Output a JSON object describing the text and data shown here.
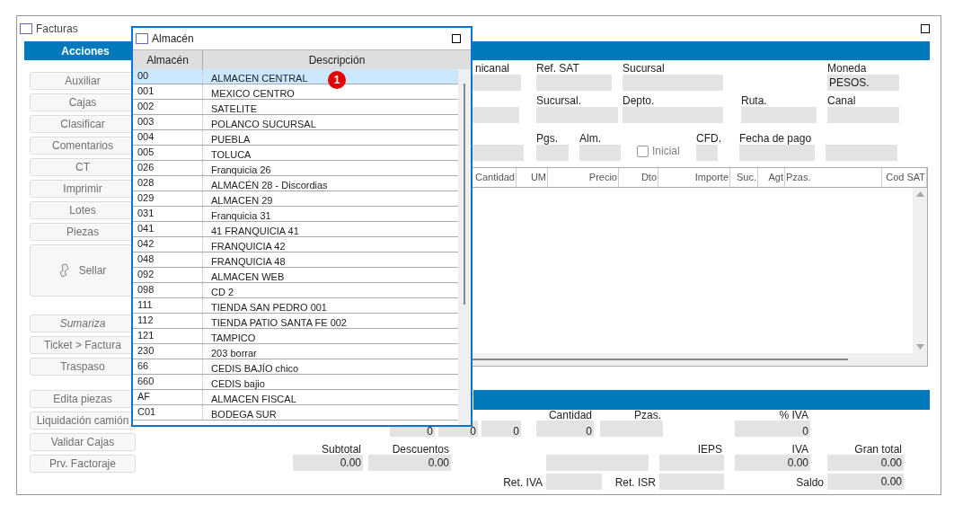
{
  "window": {
    "title": "Facturas"
  },
  "actions": {
    "title": "Acciones",
    "groups": [
      [
        {
          "label": "Auxiliar",
          "kind": "normal"
        },
        {
          "label": "Cajas",
          "kind": "normal"
        },
        {
          "label": "Clasificar",
          "kind": "normal"
        },
        {
          "label": "Comentarios",
          "kind": "normal"
        },
        {
          "label": "CT",
          "kind": "normal"
        },
        {
          "label": "Imprimir",
          "kind": "normal"
        },
        {
          "label": "Lotes",
          "kind": "normal"
        },
        {
          "label": "Piezas",
          "kind": "normal"
        },
        {
          "label": "Sellar",
          "kind": "large"
        }
      ],
      [
        {
          "label": "Sumariza",
          "kind": "italic"
        },
        {
          "label": "Ticket > Factura",
          "kind": "normal"
        },
        {
          "label": "Traspaso",
          "kind": "normal"
        }
      ],
      [
        {
          "label": "Edita piezas",
          "kind": "normal"
        },
        {
          "label": "Liquidación camión",
          "kind": "normal"
        },
        {
          "label": "Validar Cajas",
          "kind": "normal"
        },
        {
          "label": "Prv. Factoraje",
          "kind": "normal"
        }
      ]
    ]
  },
  "header_fields": [
    [
      {
        "kind": "field",
        "label": "nicanal"
      },
      {
        "kind": "field",
        "label": "Ref. SAT"
      },
      {
        "kind": "field",
        "label": "Sucursal"
      },
      {
        "kind": "field",
        "label": "Moneda",
        "value": "PESOS."
      }
    ],
    [
      {
        "kind": "field"
      },
      {
        "kind": "field",
        "label": "Sucursal."
      },
      {
        "kind": "field",
        "label": "Depto."
      },
      {
        "kind": "field",
        "label": "Ruta."
      },
      {
        "kind": "field",
        "label": "Canal"
      }
    ],
    [
      {
        "kind": "field"
      },
      {
        "kind": "field",
        "label": "Pgs."
      },
      {
        "kind": "field",
        "label": "Alm."
      },
      {
        "kind": "checkbox",
        "label": "Inicial",
        "checked": false
      },
      {
        "kind": "field",
        "label": "CFD."
      },
      {
        "kind": "field",
        "label": "Fecha de pago"
      },
      {
        "kind": "field"
      }
    ]
  ],
  "lines_table": {
    "columns": [
      "Cantidad",
      "UM",
      "Precio",
      "Dto",
      "Importe",
      "Suc.",
      "Agt",
      "Pzas.",
      "Cod SAT"
    ]
  },
  "summary": [
    [
      {
        "kind": "field",
        "value": "0"
      },
      {
        "kind": "field",
        "value": "0"
      },
      {
        "kind": "field",
        "value": "0"
      },
      {
        "kind": "field",
        "label": "Cantidad",
        "value": "0"
      },
      {
        "kind": "field",
        "label": "Pzas."
      },
      {
        "kind": "field",
        "label": "% IVA",
        "value": "0"
      }
    ],
    [
      {
        "kind": "field",
        "label": "Subtotal",
        "value": "0.00"
      },
      {
        "kind": "field",
        "label": "Descuentos",
        "value": "0.00"
      },
      {
        "kind": "field"
      },
      {
        "kind": "field",
        "label": "IEPS"
      },
      {
        "kind": "field",
        "label": "IVA",
        "value": "0.00"
      },
      {
        "kind": "field",
        "label": "Gran total",
        "value": "0.00"
      }
    ],
    [
      {
        "kind": "field",
        "label": "Ret. IVA"
      },
      {
        "kind": "field",
        "label": "Ret. ISR"
      },
      {
        "kind": "field",
        "label": "Saldo",
        "value": "0.00"
      }
    ]
  ],
  "popup": {
    "title": "Almacén",
    "columns": [
      "Almacén",
      "Descripción"
    ],
    "badge": "1",
    "rows": [
      {
        "code": "00",
        "description": "ALMACEN CENTRAL",
        "selected": true
      },
      {
        "code": "001",
        "description": "MEXICO CENTRO",
        "selected": false
      },
      {
        "code": "002",
        "description": "SATELITE",
        "selected": false
      },
      {
        "code": "003",
        "description": "POLANCO SUCURSAL",
        "selected": false
      },
      {
        "code": "004",
        "description": "PUEBLA",
        "selected": false
      },
      {
        "code": "005",
        "description": "TOLUCA",
        "selected": false
      },
      {
        "code": "026",
        "description": "Franquicia 26",
        "selected": false
      },
      {
        "code": "028",
        "description": "ALMACÉN 28 - Discordias",
        "selected": false
      },
      {
        "code": "029",
        "description": "ALMACEN 29",
        "selected": false
      },
      {
        "code": "031",
        "description": "Franquicia 31",
        "selected": false
      },
      {
        "code": "041",
        "description": "41 FRANQUICIA 41",
        "selected": false
      },
      {
        "code": "042",
        "description": "FRANQUICIA 42",
        "selected": false
      },
      {
        "code": "048",
        "description": "FRANQUICIA 48",
        "selected": false
      },
      {
        "code": "092",
        "description": "ALMACEN WEB",
        "selected": false
      },
      {
        "code": "098",
        "description": "CD 2",
        "selected": false
      },
      {
        "code": "111",
        "description": "TIENDA SAN PEDRO 001",
        "selected": false
      },
      {
        "code": "112",
        "description": "TIENDA PATIO SANTA FE 002",
        "selected": false
      },
      {
        "code": "121",
        "description": "TAMPICO",
        "selected": false
      },
      {
        "code": "230",
        "description": "203 borrar",
        "selected": false
      },
      {
        "code": "66",
        "description": "CEDIS BAJÍO chico",
        "selected": false
      },
      {
        "code": "660",
        "description": "CEDIS bajio",
        "selected": false
      },
      {
        "code": "AF",
        "description": "ALMACEN FISCAL",
        "selected": false
      },
      {
        "code": "C01",
        "description": "BODEGA SUR",
        "selected": false
      }
    ]
  }
}
